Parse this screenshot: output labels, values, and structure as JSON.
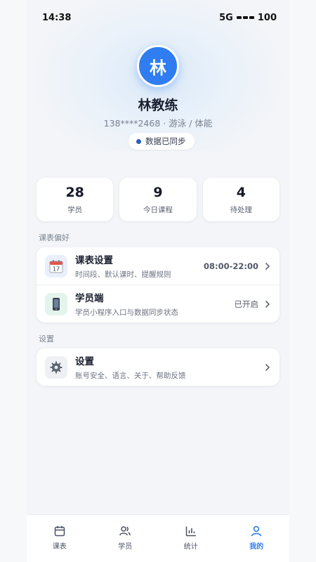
{
  "status_bar": {
    "time": "14:38",
    "network": "5G",
    "battery": "100"
  },
  "profile": {
    "avatar_char": "林",
    "name": "林教练",
    "subline": "138****2468 · 游泳 / 体能",
    "sync_label": "数据已同步"
  },
  "stats": [
    {
      "value": "28",
      "label": "学员"
    },
    {
      "value": "9",
      "label": "今日课程"
    },
    {
      "value": "4",
      "label": "待处理"
    }
  ],
  "sections": {
    "schedule_title": "课表偏好",
    "settings_title": "设置"
  },
  "schedule_rows": [
    {
      "title": "课表设置",
      "subtitle": "时间段、默认课时、提醒规则",
      "value": "08:00-22:00",
      "icon": "calendar-icon",
      "icon_text": "17"
    },
    {
      "title": "学员端",
      "subtitle": "学员小程序入口与数据同步状态",
      "value": "已开启",
      "icon": "phone-icon"
    }
  ],
  "settings_row": {
    "title": "设置",
    "subtitle": "账号安全、语言、关于、帮助反馈",
    "icon": "gear-icon"
  },
  "tabs": [
    {
      "label": "课表",
      "icon": "calendar-tab-icon"
    },
    {
      "label": "学员",
      "icon": "users-icon"
    },
    {
      "label": "统计",
      "icon": "bar-chart-icon"
    },
    {
      "label": "我的",
      "icon": "person-icon",
      "active": true
    }
  ],
  "colors": {
    "accent": "#2f7df0",
    "sync_dot": "#2b5fb8",
    "background": "#f3f5f8"
  }
}
